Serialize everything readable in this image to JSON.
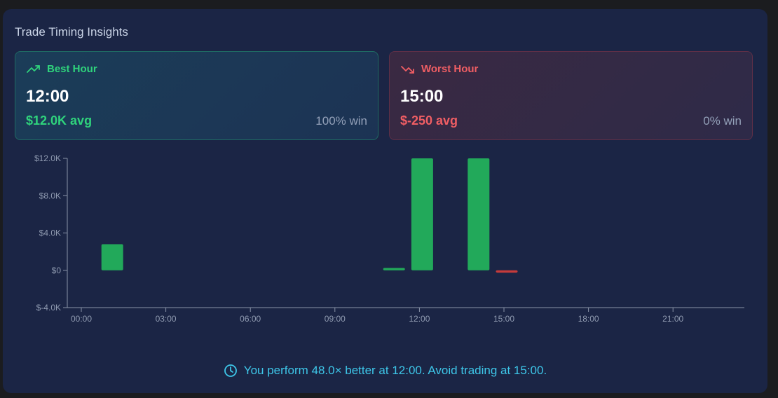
{
  "panel": {
    "title": "Trade Timing Insights"
  },
  "best": {
    "label": "Best Hour",
    "time": "12:00",
    "avg": "$12.0K avg",
    "win": "100% win",
    "icon": "trending-up-icon",
    "color": "#2fd37c"
  },
  "worst": {
    "label": "Worst Hour",
    "time": "15:00",
    "avg": "$-250 avg",
    "win": "0% win",
    "icon": "trending-down-icon",
    "color": "#f05e64"
  },
  "chart_data": {
    "type": "bar",
    "x_tick_labels": [
      "00:00",
      "03:00",
      "06:00",
      "09:00",
      "12:00",
      "15:00",
      "18:00",
      "21:00"
    ],
    "y_tick_labels": [
      "$12.0K",
      "$8.0K",
      "$4.0K",
      "$0",
      "$-4.0K"
    ],
    "y_ticks": [
      12000,
      8000,
      4000,
      0,
      -4000
    ],
    "ylim": [
      -4000,
      12000
    ],
    "hours": [
      1,
      11,
      12,
      14,
      15
    ],
    "values": [
      2800,
      250,
      12000,
      12000,
      -250
    ],
    "positive_color": "#22a95a",
    "negative_color": "#c53b3b"
  },
  "footer": {
    "note": "You perform 48.0× better at 12:00. Avoid trading at 15:00.",
    "icon": "clock-icon"
  }
}
